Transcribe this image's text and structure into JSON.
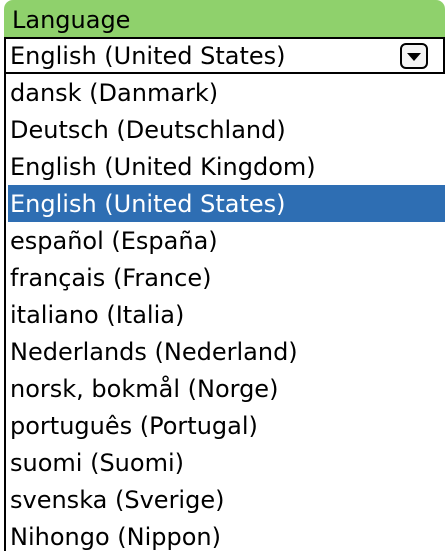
{
  "header": {
    "title": "Language",
    "color": "#8fd16c"
  },
  "select": {
    "value": "English (United States)",
    "dropdown_icon": "chevron-down-icon"
  },
  "list": {
    "selected_color": "#2e6eb3",
    "items": [
      {
        "label": "dansk (Danmark)",
        "selected": false
      },
      {
        "label": "Deutsch (Deutschland)",
        "selected": false
      },
      {
        "label": "English (United Kingdom)",
        "selected": false
      },
      {
        "label": "English (United States)",
        "selected": true
      },
      {
        "label": "español (España)",
        "selected": false
      },
      {
        "label": "français (France)",
        "selected": false
      },
      {
        "label": "italiano (Italia)",
        "selected": false
      },
      {
        "label": "Nederlands (Nederland)",
        "selected": false
      },
      {
        "label": "norsk, bokmål (Norge)",
        "selected": false
      },
      {
        "label": "português (Portugal)",
        "selected": false
      },
      {
        "label": "suomi (Suomi)",
        "selected": false
      },
      {
        "label": "svenska (Sverige)",
        "selected": false
      },
      {
        "label": "Nihongo (Nippon)",
        "selected": false
      }
    ]
  }
}
